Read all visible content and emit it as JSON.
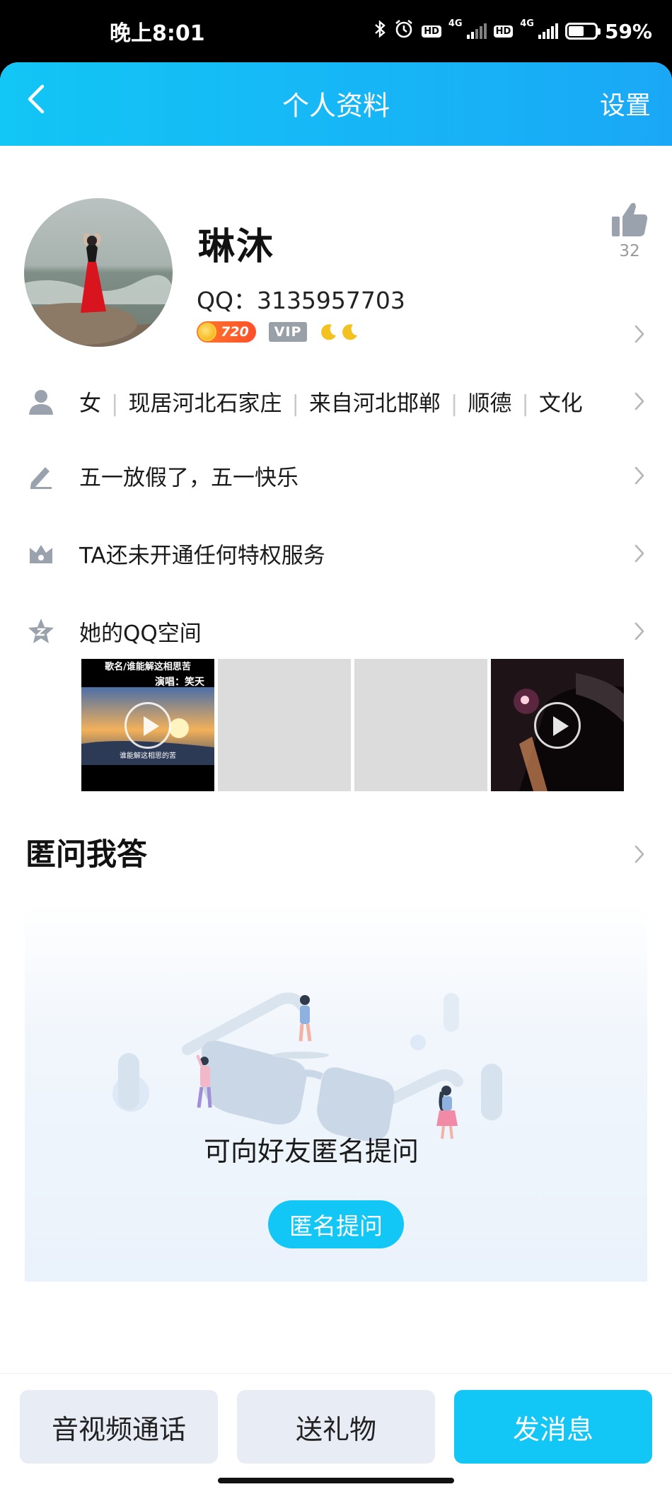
{
  "status_bar": {
    "time": "晚上8:01",
    "battery_percent": "59%",
    "battery_level": 0.59,
    "network_1": "4G",
    "network_2": "4G",
    "hd_label": "HD"
  },
  "header": {
    "title": "个人资料",
    "settings_label": "设置"
  },
  "profile": {
    "nickname": "琳沐",
    "qq_number": "QQ：3135957703",
    "coin_value": "720",
    "vip_label": "VIP",
    "like_count": "32"
  },
  "info_row": {
    "gender": "女",
    "residence": "现居河北石家庄",
    "hometown": "来自河北邯郸",
    "district": "顺德",
    "extra": "文化"
  },
  "signature": {
    "text": "五一放假了，五一快乐"
  },
  "privilege": {
    "text": "TA还未开通任何特权服务"
  },
  "qzone": {
    "label": "她的QQ空间",
    "photo_caption_title": "歌名/谁能解这相思苦",
    "photo_caption_singer": "演唱：笑天",
    "photo_caption_lyric": "谁能解这相思的苦"
  },
  "qa": {
    "section_title": "匿问我答",
    "prompt": "可向好友匿名提问",
    "button_label": "匿名提问"
  },
  "bottom_bar": {
    "call_label": "音视频通话",
    "gift_label": "送礼物",
    "message_label": "发消息"
  },
  "colors": {
    "accent": "#12c6f5",
    "button_gray": "#e8ecf5"
  }
}
